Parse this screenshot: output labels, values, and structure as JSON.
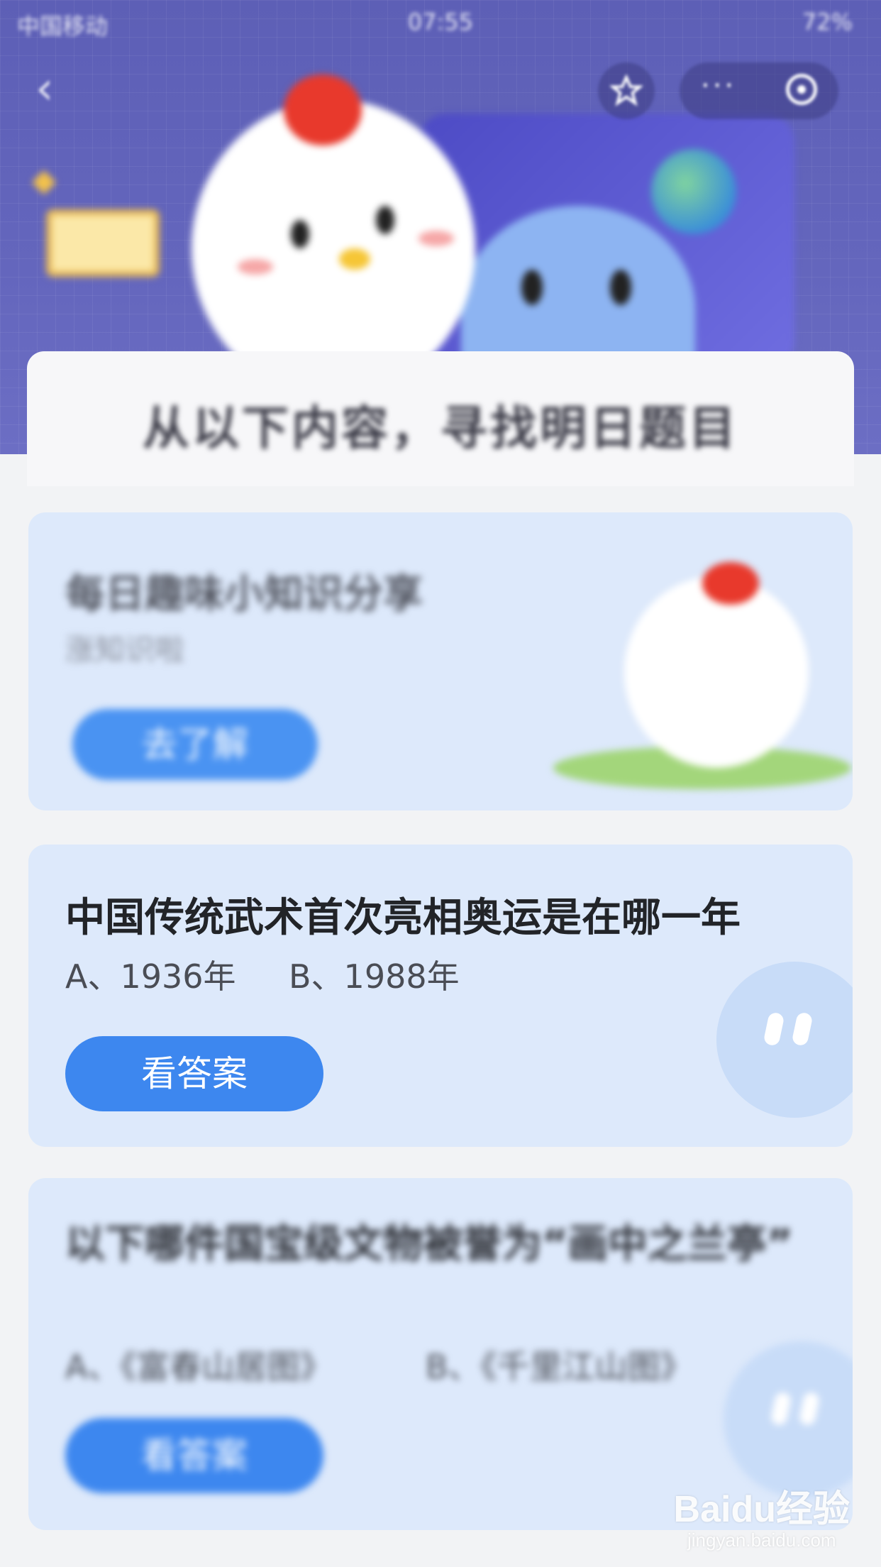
{
  "status_bar": {
    "carrier": "中国移动",
    "time": "07:55",
    "battery": "72%"
  },
  "nav": {
    "more_label": "···"
  },
  "banner": {
    "title": "从以下内容，寻找明日题目"
  },
  "cards": [
    {
      "title": "每日趣味小知识分享",
      "subtitle": "涨知识啦",
      "button": "去了解"
    },
    {
      "title": "中国传统武术首次亮相奥运是在哪一年",
      "option_a": "A、1936年",
      "option_b": "B、1988年",
      "button": "看答案"
    },
    {
      "title": "以下哪件国宝级文物被誉为“画中之兰亭”",
      "option_a": "A、《富春山居图》",
      "option_b": "B、《千里江山图》",
      "button": "看答案"
    }
  ],
  "watermark": {
    "brand": "Baidu经验",
    "url": "jingyan.baidu.com"
  },
  "colors": {
    "header": "#6466bd",
    "card": "#dde9fb",
    "button": "#3d87ef",
    "page": "#f2f3f5"
  }
}
